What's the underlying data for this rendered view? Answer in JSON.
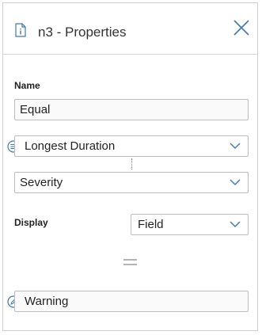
{
  "panel": {
    "title": "n3 - Properties",
    "icons": {
      "header": "document-icon",
      "close": "close-icon"
    }
  },
  "form": {
    "name_label": "Name",
    "name_value": "Equal",
    "left_operand": {
      "value": "Longest Duration",
      "icon": "list-icon"
    },
    "right_operand": {
      "value": "Severity"
    },
    "display_label": "Display",
    "display_value": "Field",
    "operator_icon": "equals-icon",
    "output": {
      "value": "Warning",
      "icon": "edit-icon"
    }
  },
  "colors": {
    "accent": "#3d78b8",
    "border": "#bdbdbd",
    "text": "#222222"
  }
}
